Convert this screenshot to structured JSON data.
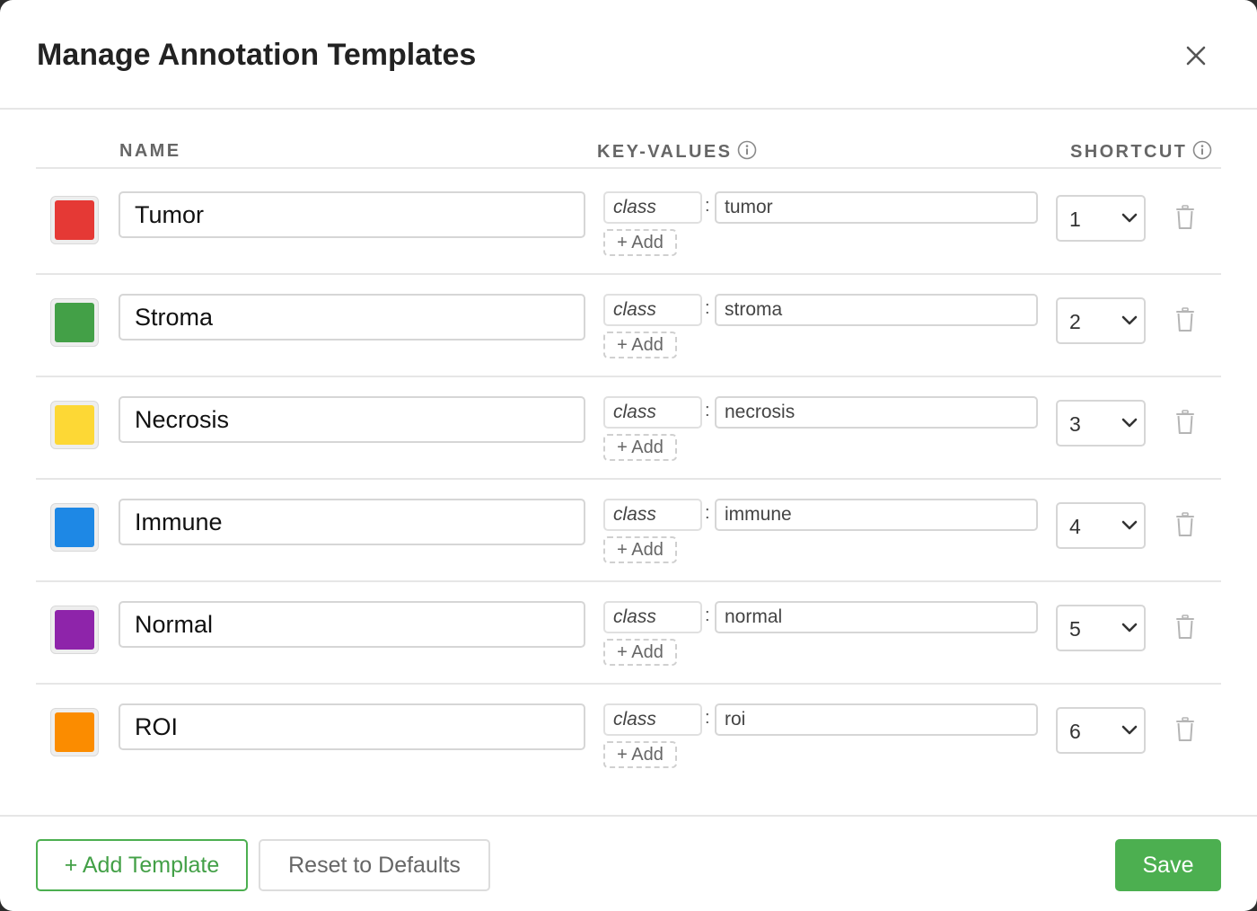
{
  "dialog": {
    "title": "Manage Annotation Templates",
    "close_icon": "close-icon"
  },
  "columns": {
    "name": "NAME",
    "key_values": "KEY-VALUES",
    "shortcut": "SHORTCUT",
    "info_icon": "info-icon"
  },
  "templates": [
    {
      "name": "Tumor",
      "color": "#e53935",
      "key": "class",
      "value": "tumor",
      "add_label": "+ Add",
      "shortcut": "1"
    },
    {
      "name": "Stroma",
      "color": "#43a047",
      "key": "class",
      "value": "stroma",
      "add_label": "+ Add",
      "shortcut": "2"
    },
    {
      "name": "Necrosis",
      "color": "#fdd835",
      "key": "class",
      "value": "necrosis",
      "add_label": "+ Add",
      "shortcut": "3"
    },
    {
      "name": "Immune",
      "color": "#1e88e5",
      "key": "class",
      "value": "immune",
      "add_label": "+ Add",
      "shortcut": "4"
    },
    {
      "name": "Normal",
      "color": "#8e24aa",
      "key": "class",
      "value": "normal",
      "add_label": "+ Add",
      "shortcut": "5"
    },
    {
      "name": "ROI",
      "color": "#fb8c00",
      "key": "class",
      "value": "roi",
      "add_label": "+ Add",
      "shortcut": "6"
    }
  ],
  "icons": {
    "shortcut_dropdown": "chevron-down-icon",
    "delete": "trash-icon"
  },
  "footer": {
    "add_template_label": "+ Add Template",
    "reset_label": "Reset to Defaults",
    "save_label": "Save"
  },
  "colors": {
    "accent": "#4caf50",
    "border": "#d6d6d6"
  }
}
